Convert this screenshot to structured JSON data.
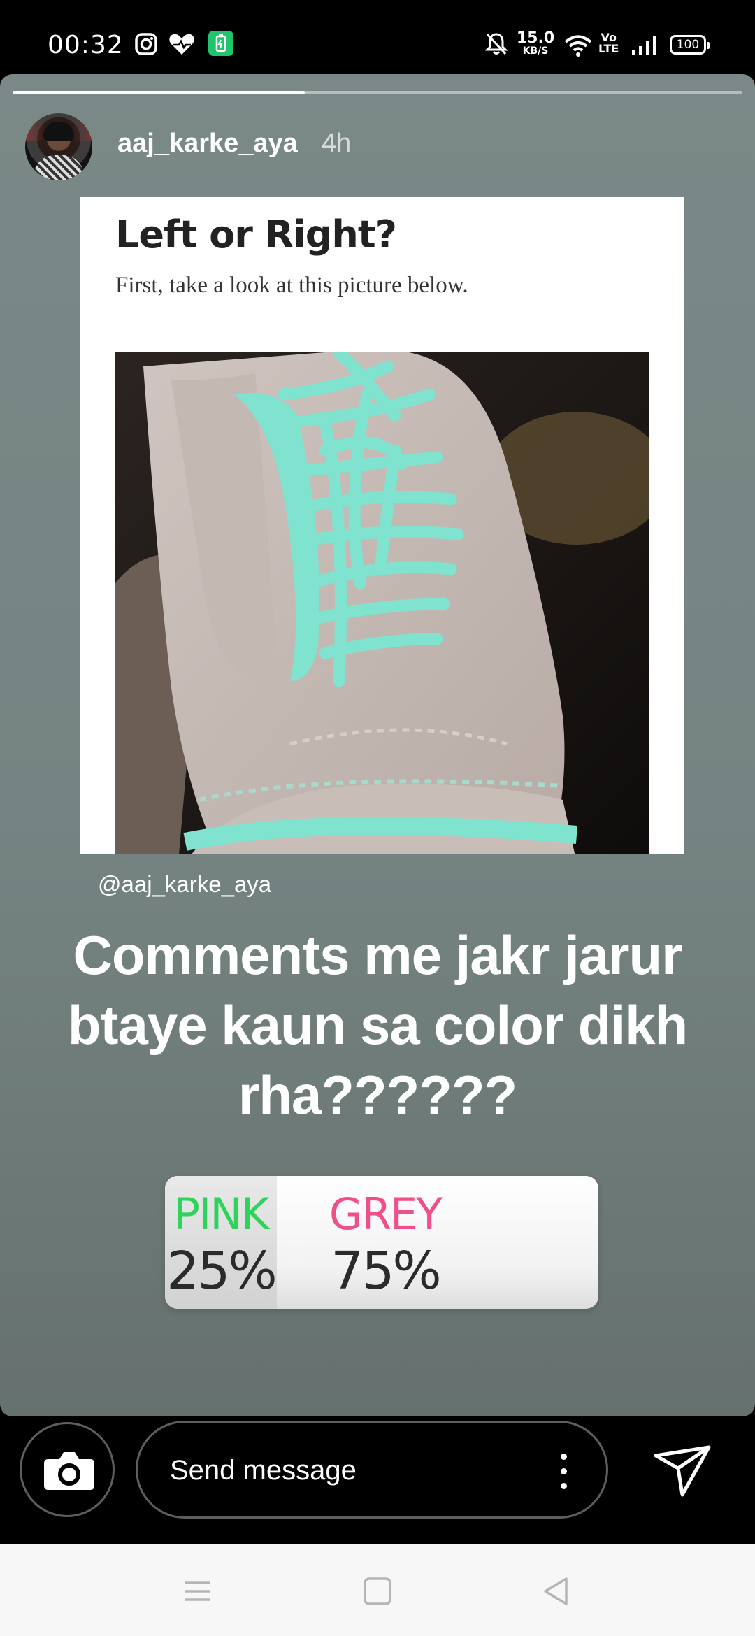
{
  "status_bar": {
    "time": "00:32",
    "net_speed_value": "15.0",
    "net_speed_unit": "KB/S",
    "volte_top": "Vo",
    "volte_bottom": "LTE",
    "battery": "100",
    "icons": [
      "instagram-icon",
      "heart-icon",
      "battery-saver-icon",
      "mute-icon",
      "wifi-icon",
      "signal-icon",
      "battery-icon"
    ]
  },
  "story": {
    "progress": 0.4,
    "username": "aaj_karke_aya",
    "time_ago": "4h",
    "post": {
      "title": "Left or Right?",
      "subtitle": "First, take a look at this picture below."
    },
    "mention": "@aaj_karke_aya",
    "caption": "Comments me jakr jarur btaye kaun sa color dikh rha??????",
    "poll": {
      "options": [
        {
          "label": "PINK",
          "percent": "25%",
          "color": "#2fd25a"
        },
        {
          "label": "GREY",
          "percent": "75%",
          "color": "#ef4f8a"
        }
      ]
    }
  },
  "reply_bar": {
    "placeholder": "Send message"
  },
  "colors": {
    "story_bg": "#758482",
    "shoe_teal": "#7fe3cf",
    "shoe_pink": "#c9bdb8"
  }
}
